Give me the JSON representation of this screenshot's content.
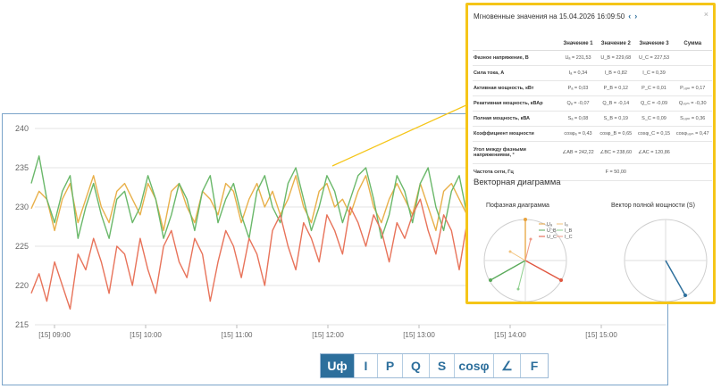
{
  "toolbar": {
    "buttons": [
      {
        "label": "Uф",
        "active": true
      },
      {
        "label": "I",
        "active": false
      },
      {
        "label": "P",
        "active": false
      },
      {
        "label": "Q",
        "active": false
      },
      {
        "label": "S",
        "active": false
      },
      {
        "label": "cosφ",
        "active": false
      },
      {
        "label": "∠",
        "active": false
      },
      {
        "label": "F",
        "active": false
      }
    ]
  },
  "popup": {
    "title": "Мгновенные значения на 15.04.2026 16:09:50",
    "nav_prev": "‹",
    "nav_next": "›",
    "close": "×",
    "headers": [
      "",
      "Значение 1",
      "Значение 2",
      "Значение 3",
      "Сумма"
    ],
    "rows": [
      {
        "label": "Фазное напряжение, В",
        "v1": "Uₐ = 231,53",
        "v2": "U_B = 229,68",
        "v3": "U_C = 227,53",
        "sum": ""
      },
      {
        "label": "Сила тока, А",
        "v1": "Iₐ = 0,34",
        "v2": "I_B = 0,82",
        "v3": "I_C = 0,39",
        "sum": ""
      },
      {
        "label": "Активная мощность, кВт",
        "v1": "Pₐ = 0,03",
        "v2": "P_B = 0,12",
        "v3": "P_C = 0,01",
        "sum": "Pₛᵤₘ = 0,17"
      },
      {
        "label": "Реактивная мощность, кВАр",
        "v1": "Qₐ = -0,07",
        "v2": "Q_B = -0,14",
        "v3": "Q_C = -0,09",
        "sum": "Qₛᵤₘ = -0,30"
      },
      {
        "label": "Полная мощность, кВА",
        "v1": "Sₐ = 0,08",
        "v2": "S_B = 0,19",
        "v3": "S_C = 0,09",
        "sum": "Sₛᵤₘ = 0,36"
      },
      {
        "label": "Коэффициент мощности",
        "v1": "cosφₐ = 0,43",
        "v2": "cosφ_B = 0,65",
        "v3": "cosφ_C = 0,15",
        "sum": "cosφₛᵤₘ = 0,47"
      },
      {
        "label": "Угол между фазными напряжениями, °",
        "v1": "∠AB = 242,22",
        "v2": "∠BC = 238,60",
        "v3": "∠AC = 120,86",
        "sum": ""
      },
      {
        "label": "Частота сети, Гц",
        "v1": "",
        "v2": "F = 50,00",
        "v3": "",
        "sum": ""
      }
    ],
    "vector_title": "Векторная диаграмма",
    "phase_diagram_title": "Пофазная диаграмма",
    "power_vector_title": "Вектор полной мощности (S)",
    "legend": [
      {
        "u": "Uₐ",
        "i": "Iₐ",
        "u_color": "#e8a33d",
        "i_color": "#f2c27a"
      },
      {
        "u": "U_B",
        "i": "I_B",
        "u_color": "#5aaa5a",
        "i_color": "#8fcf8f"
      },
      {
        "u": "U_C",
        "i": "I_C",
        "u_color": "#e0563f",
        "i_color": "#ef9a88"
      }
    ]
  },
  "chart_data": {
    "type": "line",
    "ylim": [
      215,
      240
    ],
    "yticks": [
      215,
      220,
      225,
      230,
      235,
      240
    ],
    "xticks": [
      "[15] 09:00",
      "[15] 10:00",
      "[15] 11:00",
      "[15] 12:00",
      "[15] 13:00",
      "[15] 14:00",
      "[15] 15:00"
    ],
    "grid": true,
    "series": [
      {
        "color": "#e8b04a",
        "values": [
          229.8,
          232,
          231,
          227,
          231,
          233,
          228,
          231,
          234,
          230,
          228,
          232,
          233,
          231,
          229,
          233,
          231,
          227,
          232,
          233,
          230,
          228,
          232,
          231,
          229,
          233,
          232,
          228,
          231,
          233,
          230,
          232,
          229,
          231,
          234,
          230,
          228,
          232,
          233,
          230,
          231,
          229,
          232,
          234,
          230,
          228,
          231,
          233,
          231,
          229,
          233,
          230,
          227,
          232,
          233,
          231,
          229,
          232,
          230,
          228,
          233,
          231,
          229,
          232,
          234,
          230,
          228,
          231,
          233,
          232,
          229,
          231,
          233,
          230,
          228,
          232,
          231,
          229,
          233,
          230
        ]
      },
      {
        "color": "#6ab86a",
        "values": [
          233,
          236.5,
          231,
          228,
          232,
          234,
          226,
          230,
          233,
          229,
          226,
          231,
          232,
          228,
          230,
          234,
          231,
          226,
          229,
          233,
          231,
          227,
          232,
          234,
          228,
          231,
          233,
          229,
          226,
          232,
          234,
          230,
          228,
          233,
          235,
          231,
          227,
          230,
          234,
          232,
          228,
          231,
          234,
          235,
          231,
          226,
          229,
          234,
          232,
          228,
          233,
          235,
          230,
          227,
          232,
          234,
          229,
          231,
          233,
          227,
          229,
          234,
          231,
          228,
          233,
          231,
          226,
          230,
          234,
          232,
          227,
          231,
          233,
          229,
          227,
          232,
          234,
          230,
          228,
          231
        ]
      },
      {
        "color": "#e8735a",
        "values": [
          219,
          221.5,
          218,
          223,
          220,
          217,
          224,
          222,
          226,
          223,
          219,
          225,
          224,
          220,
          226,
          222,
          219,
          225,
          227,
          223,
          221,
          226,
          224,
          218,
          223,
          227,
          225,
          221,
          226,
          224,
          220,
          227,
          229,
          225,
          222,
          228,
          226,
          223,
          229,
          227,
          224,
          230,
          228,
          225,
          229,
          227,
          223,
          228,
          226,
          229,
          231,
          227,
          224,
          229,
          227,
          222,
          228,
          230,
          226,
          229,
          231,
          227,
          224,
          230,
          228,
          225,
          229,
          227,
          223,
          228,
          230,
          226,
          229,
          231,
          227,
          224,
          229,
          228,
          226,
          230
        ]
      }
    ]
  }
}
